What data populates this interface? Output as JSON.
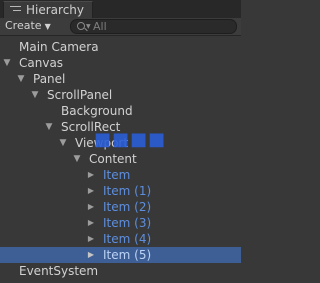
{
  "window": {
    "tab_title": "Hierarchy"
  },
  "toolbar": {
    "create_label": "Create",
    "search_placeholder": "All"
  },
  "tree": [
    {
      "label": "Main Camera",
      "depth": 0,
      "arrow": "none",
      "prefab": false,
      "selected": false
    },
    {
      "label": "Canvas",
      "depth": 0,
      "arrow": "expanded",
      "prefab": false,
      "selected": false
    },
    {
      "label": "Panel",
      "depth": 1,
      "arrow": "expanded",
      "prefab": false,
      "selected": false
    },
    {
      "label": "ScrollPanel",
      "depth": 2,
      "arrow": "expanded",
      "prefab": false,
      "selected": false
    },
    {
      "label": "Background",
      "depth": 3,
      "arrow": "none",
      "prefab": false,
      "selected": false
    },
    {
      "label": "ScrollRect",
      "depth": 3,
      "arrow": "expanded",
      "prefab": false,
      "selected": false
    },
    {
      "label": "Viewport",
      "depth": 4,
      "arrow": "expanded",
      "prefab": false,
      "selected": false
    },
    {
      "label": "Content",
      "depth": 5,
      "arrow": "expanded",
      "prefab": false,
      "selected": false
    },
    {
      "label": "Item",
      "depth": 6,
      "arrow": "collapsed",
      "prefab": true,
      "selected": false
    },
    {
      "label": "Item (1)",
      "depth": 6,
      "arrow": "collapsed",
      "prefab": true,
      "selected": false
    },
    {
      "label": "Item (2)",
      "depth": 6,
      "arrow": "collapsed",
      "prefab": true,
      "selected": false
    },
    {
      "label": "Item (3)",
      "depth": 6,
      "arrow": "collapsed",
      "prefab": true,
      "selected": false
    },
    {
      "label": "Item (4)",
      "depth": 6,
      "arrow": "collapsed",
      "prefab": true,
      "selected": false
    },
    {
      "label": "Item (5)",
      "depth": 6,
      "arrow": "collapsed",
      "prefab": true,
      "selected": true
    },
    {
      "label": "EventSystem",
      "depth": 0,
      "arrow": "none",
      "prefab": false,
      "selected": false
    }
  ],
  "colors": {
    "background": "#383838",
    "selection": "#3e5f96",
    "prefab_text": "#5d8ede",
    "text": "#d2d2d2"
  },
  "icons": {
    "tab": "hierarchy-list-icon",
    "search": "search-icon",
    "expanded": "triangle-down-icon",
    "collapsed": "triangle-right-icon"
  }
}
